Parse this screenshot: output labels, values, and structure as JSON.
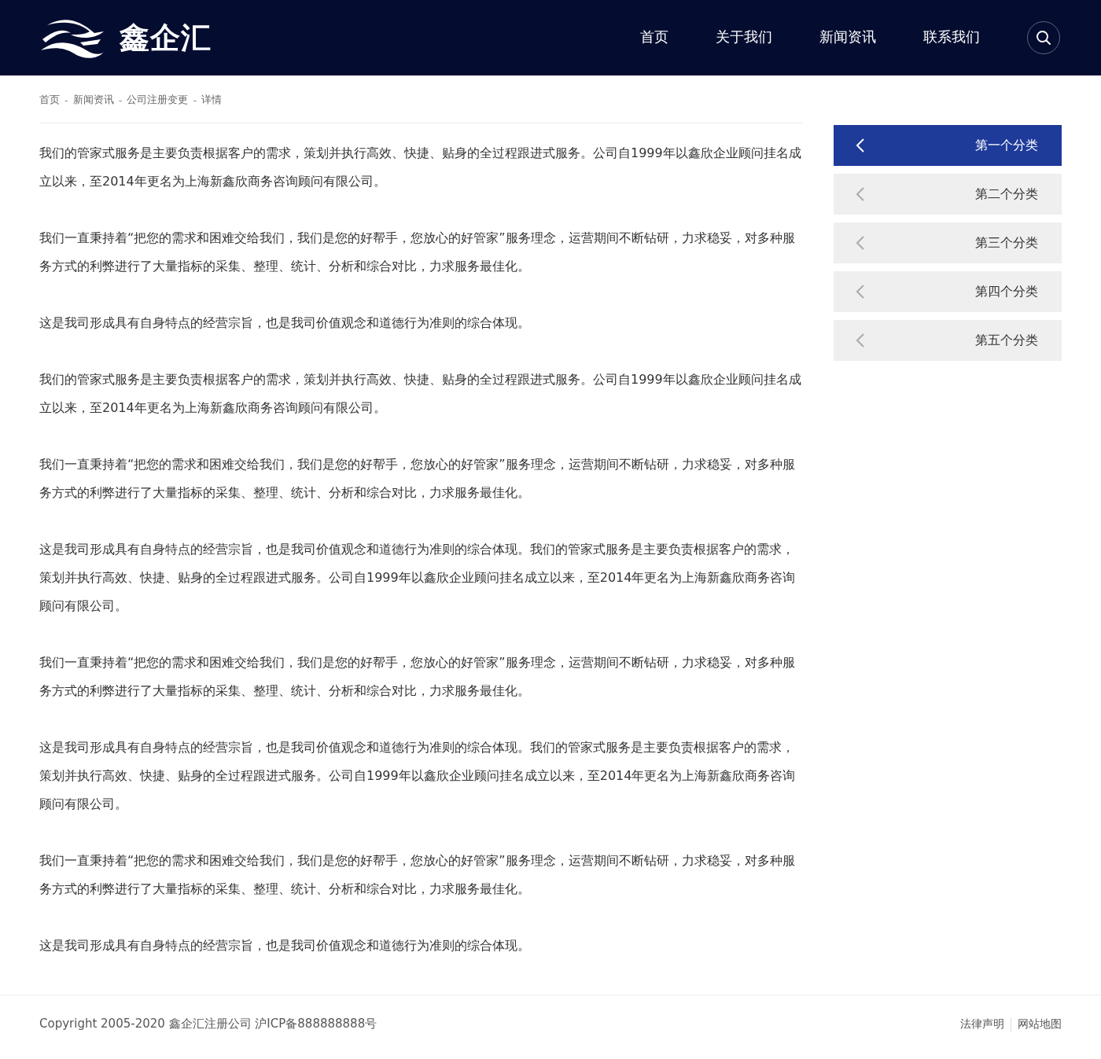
{
  "header": {
    "brand": "鑫企汇",
    "nav": [
      {
        "label": "首页",
        "selected": false
      },
      {
        "label": "关于我们",
        "selected": false
      },
      {
        "label": "新闻资讯",
        "selected": false
      },
      {
        "label": "联系我们",
        "selected": false
      }
    ]
  },
  "breadcrumb": [
    {
      "kind": "link",
      "text": "首页"
    },
    {
      "kind": "separator",
      "text": "-"
    },
    {
      "kind": "link",
      "text": "新闻资讯"
    },
    {
      "kind": "separator",
      "text": "-"
    },
    {
      "kind": "link",
      "text": "公司注册变更"
    },
    {
      "kind": "separator",
      "text": "-"
    },
    {
      "kind": "current",
      "text": "详情"
    }
  ],
  "article": {
    "paragraphs": [
      "我们的管家式服务是主要负责根据客户的需求，策划并执行高效、快捷、贴身的全过程跟进式服务。公司自1999年以鑫欣企业顾问挂名成立以来，至2014年更名为上海新鑫欣商务咨询顾问有限公司。",
      "我们一直秉持着“把您的需求和困难交给我们，我们是您的好帮手，您放心的好管家”服务理念，运营期间不断钻研，力求稳妥，对多种服务方式的利弊进行了大量指标的采集、整理、统计、分析和综合对比，力求服务最佳化。",
      "这是我司形成具有自身特点的经营宗旨，也是我司价值观念和道德行为准则的综合体现。",
      "我们的管家式服务是主要负责根据客户的需求，策划并执行高效、快捷、贴身的全过程跟进式服务。公司自1999年以鑫欣企业顾问挂名成立以来，至2014年更名为上海新鑫欣商务咨询顾问有限公司。",
      "我们一直秉持着“把您的需求和困难交给我们，我们是您的好帮手，您放心的好管家”服务理念，运营期间不断钻研，力求稳妥，对多种服务方式的利弊进行了大量指标的采集、整理、统计、分析和综合对比，力求服务最佳化。",
      "这是我司形成具有自身特点的经营宗旨，也是我司价值观念和道德行为准则的综合体现。我们的管家式服务是主要负责根据客户的需求，策划并执行高效、快捷、贴身的全过程跟进式服务。公司自1999年以鑫欣企业顾问挂名成立以来，至2014年更名为上海新鑫欣商务咨询顾问有限公司。",
      "我们一直秉持着“把您的需求和困难交给我们，我们是您的好帮手，您放心的好管家”服务理念，运营期间不断钻研，力求稳妥，对多种服务方式的利弊进行了大量指标的采集、整理、统计、分析和综合对比，力求服务最佳化。",
      "这是我司形成具有自身特点的经营宗旨，也是我司价值观念和道德行为准则的综合体现。我们的管家式服务是主要负责根据客户的需求，策划并执行高效、快捷、贴身的全过程跟进式服务。公司自1999年以鑫欣企业顾问挂名成立以来，至2014年更名为上海新鑫欣商务咨询顾问有限公司。",
      "我们一直秉持着“把您的需求和困难交给我们，我们是您的好帮手，您放心的好管家”服务理念，运营期间不断钻研，力求稳妥，对多种服务方式的利弊进行了大量指标的采集、整理、统计、分析和综合对比，力求服务最佳化。",
      "这是我司形成具有自身特点的经营宗旨，也是我司价值观念和道德行为准则的综合体现。"
    ]
  },
  "sidebar": {
    "categories": [
      {
        "label": "第一个分类",
        "selected": true
      },
      {
        "label": "第二个分类",
        "selected": false
      },
      {
        "label": "第三个分类",
        "selected": false
      },
      {
        "label": "第四个分类",
        "selected": false
      },
      {
        "label": "第五个分类",
        "selected": false
      }
    ]
  },
  "footer": {
    "copyright": "Copyright 2005-2020 鑫企汇注册公司 沪ICP备888888888号",
    "links": [
      "法律声明",
      "网站地图"
    ]
  }
}
